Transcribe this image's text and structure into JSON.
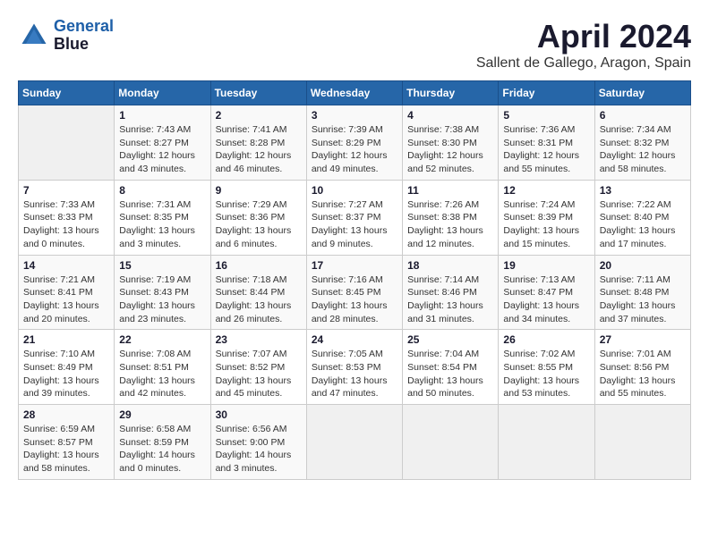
{
  "app": {
    "name": "GeneralBlue",
    "logo_line1": "General",
    "logo_line2": "Blue"
  },
  "calendar": {
    "title": "April 2024",
    "subtitle": "Sallent de Gallego, Aragon, Spain",
    "days_of_week": [
      "Sunday",
      "Monday",
      "Tuesday",
      "Wednesday",
      "Thursday",
      "Friday",
      "Saturday"
    ],
    "weeks": [
      [
        {
          "day": "",
          "info": ""
        },
        {
          "day": "1",
          "info": "Sunrise: 7:43 AM\nSunset: 8:27 PM\nDaylight: 12 hours and 43 minutes."
        },
        {
          "day": "2",
          "info": "Sunrise: 7:41 AM\nSunset: 8:28 PM\nDaylight: 12 hours and 46 minutes."
        },
        {
          "day": "3",
          "info": "Sunrise: 7:39 AM\nSunset: 8:29 PM\nDaylight: 12 hours and 49 minutes."
        },
        {
          "day": "4",
          "info": "Sunrise: 7:38 AM\nSunset: 8:30 PM\nDaylight: 12 hours and 52 minutes."
        },
        {
          "day": "5",
          "info": "Sunrise: 7:36 AM\nSunset: 8:31 PM\nDaylight: 12 hours and 55 minutes."
        },
        {
          "day": "6",
          "info": "Sunrise: 7:34 AM\nSunset: 8:32 PM\nDaylight: 12 hours and 58 minutes."
        }
      ],
      [
        {
          "day": "7",
          "info": "Sunrise: 7:33 AM\nSunset: 8:33 PM\nDaylight: 13 hours and 0 minutes."
        },
        {
          "day": "8",
          "info": "Sunrise: 7:31 AM\nSunset: 8:35 PM\nDaylight: 13 hours and 3 minutes."
        },
        {
          "day": "9",
          "info": "Sunrise: 7:29 AM\nSunset: 8:36 PM\nDaylight: 13 hours and 6 minutes."
        },
        {
          "day": "10",
          "info": "Sunrise: 7:27 AM\nSunset: 8:37 PM\nDaylight: 13 hours and 9 minutes."
        },
        {
          "day": "11",
          "info": "Sunrise: 7:26 AM\nSunset: 8:38 PM\nDaylight: 13 hours and 12 minutes."
        },
        {
          "day": "12",
          "info": "Sunrise: 7:24 AM\nSunset: 8:39 PM\nDaylight: 13 hours and 15 minutes."
        },
        {
          "day": "13",
          "info": "Sunrise: 7:22 AM\nSunset: 8:40 PM\nDaylight: 13 hours and 17 minutes."
        }
      ],
      [
        {
          "day": "14",
          "info": "Sunrise: 7:21 AM\nSunset: 8:41 PM\nDaylight: 13 hours and 20 minutes."
        },
        {
          "day": "15",
          "info": "Sunrise: 7:19 AM\nSunset: 8:43 PM\nDaylight: 13 hours and 23 minutes."
        },
        {
          "day": "16",
          "info": "Sunrise: 7:18 AM\nSunset: 8:44 PM\nDaylight: 13 hours and 26 minutes."
        },
        {
          "day": "17",
          "info": "Sunrise: 7:16 AM\nSunset: 8:45 PM\nDaylight: 13 hours and 28 minutes."
        },
        {
          "day": "18",
          "info": "Sunrise: 7:14 AM\nSunset: 8:46 PM\nDaylight: 13 hours and 31 minutes."
        },
        {
          "day": "19",
          "info": "Sunrise: 7:13 AM\nSunset: 8:47 PM\nDaylight: 13 hours and 34 minutes."
        },
        {
          "day": "20",
          "info": "Sunrise: 7:11 AM\nSunset: 8:48 PM\nDaylight: 13 hours and 37 minutes."
        }
      ],
      [
        {
          "day": "21",
          "info": "Sunrise: 7:10 AM\nSunset: 8:49 PM\nDaylight: 13 hours and 39 minutes."
        },
        {
          "day": "22",
          "info": "Sunrise: 7:08 AM\nSunset: 8:51 PM\nDaylight: 13 hours and 42 minutes."
        },
        {
          "day": "23",
          "info": "Sunrise: 7:07 AM\nSunset: 8:52 PM\nDaylight: 13 hours and 45 minutes."
        },
        {
          "day": "24",
          "info": "Sunrise: 7:05 AM\nSunset: 8:53 PM\nDaylight: 13 hours and 47 minutes."
        },
        {
          "day": "25",
          "info": "Sunrise: 7:04 AM\nSunset: 8:54 PM\nDaylight: 13 hours and 50 minutes."
        },
        {
          "day": "26",
          "info": "Sunrise: 7:02 AM\nSunset: 8:55 PM\nDaylight: 13 hours and 53 minutes."
        },
        {
          "day": "27",
          "info": "Sunrise: 7:01 AM\nSunset: 8:56 PM\nDaylight: 13 hours and 55 minutes."
        }
      ],
      [
        {
          "day": "28",
          "info": "Sunrise: 6:59 AM\nSunset: 8:57 PM\nDaylight: 13 hours and 58 minutes."
        },
        {
          "day": "29",
          "info": "Sunrise: 6:58 AM\nSunset: 8:59 PM\nDaylight: 14 hours and 0 minutes."
        },
        {
          "day": "30",
          "info": "Sunrise: 6:56 AM\nSunset: 9:00 PM\nDaylight: 14 hours and 3 minutes."
        },
        {
          "day": "",
          "info": ""
        },
        {
          "day": "",
          "info": ""
        },
        {
          "day": "",
          "info": ""
        },
        {
          "day": "",
          "info": ""
        }
      ]
    ]
  }
}
